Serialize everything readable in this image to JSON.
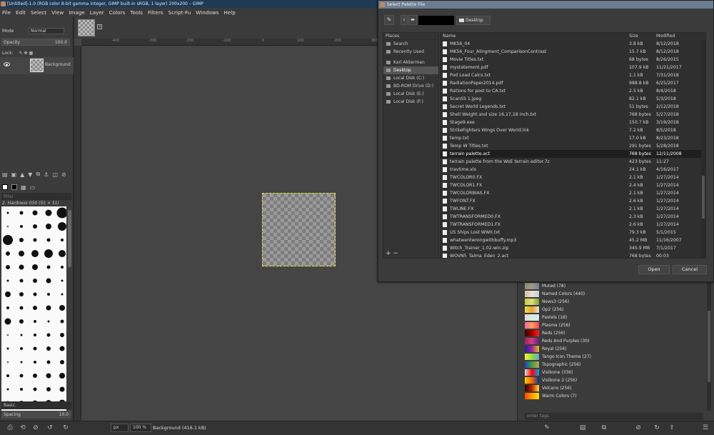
{
  "window": {
    "title": "[Untitled]-1.0 (RGB color 8-bit gamma integer, GIMP built-in sRGB, 1 layer) 200x200 – GIMP"
  },
  "menu": [
    "File",
    "Edit",
    "Select",
    "View",
    "Image",
    "Layer",
    "Colors",
    "Tools",
    "Filters",
    "Script-Fu",
    "Windows",
    "Help"
  ],
  "layers": {
    "mode_label": "Mode",
    "mode_value": "Normal",
    "opacity_label": "Opacity",
    "opacity_value": "100.0",
    "lock_label": "Lock:",
    "layer_name": "Background"
  },
  "brushes": {
    "filter_placeholder": "filter",
    "current": "2. Hardness 050 (51 × 51)",
    "preset": "Basic.",
    "spacing_label": "Spacing",
    "spacing_value": "10.0"
  },
  "ruler": [
    "-400",
    "-300",
    "-200",
    "-100",
    "0",
    "100",
    "200",
    "300",
    "400",
    "500"
  ],
  "status": {
    "unit": "px",
    "zoom": "100 %",
    "message": "Background (416.1 kB)"
  },
  "dialog": {
    "title": "Select Palette File",
    "path_current": "Desktop",
    "places_header": "Places",
    "places": [
      {
        "label": "Search",
        "selected": false
      },
      {
        "label": "Recently Used",
        "selected": false
      },
      {
        "label": "",
        "separator": true
      },
      {
        "label": "Karl Akkerman",
        "selected": false
      },
      {
        "label": "Desktop",
        "selected": true
      },
      {
        "label": "Local Disk (C:)",
        "selected": false
      },
      {
        "label": "BD-ROM Drive (D:)",
        "selected": false
      },
      {
        "label": "Local Disk (E:)",
        "selected": false
      },
      {
        "label": "Local Disk (F:)",
        "selected": false
      }
    ],
    "columns": {
      "name": "Name",
      "size": "Size",
      "modified": "Modified"
    },
    "files": [
      {
        "name": "MK56_04",
        "size": "3.8 kB",
        "modified": "8/12/2018"
      },
      {
        "name": "MK56_Four_Alingment_ComparisonContrast",
        "size": "15.7 kB",
        "modified": "8/12/2018"
      },
      {
        "name": "Movie Titles.txt",
        "size": "68 bytes",
        "modified": "8/26/2015"
      },
      {
        "name": "mystatement.pdf",
        "size": "107.9 kB",
        "modified": "11/21/2017"
      },
      {
        "name": "Pod Load Calcs.txt",
        "size": "1.1 kB",
        "modified": "7/31/2018"
      },
      {
        "name": "RadiationPaper2014.pdf",
        "size": "988.8 kB",
        "modified": "6/25/2017"
      },
      {
        "name": "Rations for post to CA.txt",
        "size": "2.5 kB",
        "modified": "8/4/2018"
      },
      {
        "name": "ScanSS 1.jpeg",
        "size": "82.1 kB",
        "modified": "5/3/2018"
      },
      {
        "name": "Secret World Legends.txt",
        "size": "51 bytes",
        "modified": "2/12/2018"
      },
      {
        "name": "Shell Weight and size 16,17,18 inch.txt",
        "size": "768 bytes",
        "modified": "5/27/2018"
      },
      {
        "name": "Stage9.exe",
        "size": "150.7 kB",
        "modified": "3/19/2018"
      },
      {
        "name": "StrikeFighters Wings Over World.lnk",
        "size": "7.2 kB",
        "modified": "8/5/2018"
      },
      {
        "name": "temp.txt",
        "size": "17.0 kB",
        "modified": "8/23/2018"
      },
      {
        "name": "Temp W Titles.txt",
        "size": "291 bytes",
        "modified": "5/28/2018"
      },
      {
        "name": "terrain palette.act",
        "size": "768 bytes",
        "modified": "12/11/2008",
        "selected": true
      },
      {
        "name": "terrain palette from the WoE terrain editor.7z",
        "size": "423 bytes",
        "modified": "11:27"
      },
      {
        "name": "travtime.xls",
        "size": "24.1 kB",
        "modified": "4/16/2017"
      },
      {
        "name": "TWCOLOR0.FX",
        "size": "2.1 kB",
        "modified": "1/27/2014"
      },
      {
        "name": "TWCOLOR1.FX",
        "size": "2.4 kB",
        "modified": "1/27/2014"
      },
      {
        "name": "TWCOLORBIAS.FX",
        "size": "2.1 kB",
        "modified": "1/27/2014"
      },
      {
        "name": "TWFONT.FX",
        "size": "2.6 kB",
        "modified": "1/27/2014"
      },
      {
        "name": "TWLINE.FX",
        "size": "2.1 kB",
        "modified": "1/27/2014"
      },
      {
        "name": "TWTRANSFORMED0.FX",
        "size": "2.3 kB",
        "modified": "1/27/2014"
      },
      {
        "name": "TWTRANSFORMED1.FX",
        "size": "2.6 kB",
        "modified": "1/27/2014"
      },
      {
        "name": "US Ships Lost WWII.txt",
        "size": "79.3 kB",
        "modified": "5/1/2015"
      },
      {
        "name": "whatwentwrongwithbuffy.mp3",
        "size": "45.2 MB",
        "modified": "11/16/2007"
      },
      {
        "name": "Witch_Trainer_1.02-win.zip",
        "size": "345.9 MB",
        "modified": "7/1/2017"
      },
      {
        "name": "WOVN5_Talma_Eden_2.act",
        "size": "768 bytes",
        "modified": "00:03"
      }
    ],
    "open_label": "Open",
    "cancel_label": "Cancel"
  },
  "palettes": {
    "items": [
      {
        "name": "Muted (78)",
        "colors": [
          "#8a8a7a",
          "#a09a88",
          "#7a8090"
        ]
      },
      {
        "name": "Named Colors (440)",
        "colors": [
          "#d0c0a0",
          "#f0e0d0",
          "#c0d0e0"
        ]
      },
      {
        "name": "News3 (256)",
        "colors": [
          "#c0d040",
          "#e0e080",
          "#80a030"
        ]
      },
      {
        "name": "Op2 (256)",
        "colors": [
          "#e0e040",
          "#f0a030",
          "#e0e0e0"
        ]
      },
      {
        "name": "Pastels (18)",
        "colors": [
          "#f0d0e0",
          "#d0f0e0",
          "#e0e0f0"
        ]
      },
      {
        "name": "Plasma (256)",
        "colors": [
          "#ff60a0",
          "#ffa060",
          "#ff4060"
        ]
      },
      {
        "name": "Reds (256)",
        "colors": [
          "#300000",
          "#a00000",
          "#ff2020"
        ]
      },
      {
        "name": "Reds And Purples (30)",
        "colors": [
          "#a02060",
          "#d04080",
          "#602080"
        ]
      },
      {
        "name": "Royal (256)",
        "colors": [
          "#2020a0",
          "#a020a0",
          "#e0c020"
        ]
      },
      {
        "name": "Tango Icon Theme (27)",
        "colors": [
          "#fce94f",
          "#8ae234",
          "#729fcf"
        ]
      },
      {
        "name": "Topographic (256)",
        "colors": [
          "#2040c0",
          "#40a040",
          "#c0a060"
        ]
      },
      {
        "name": "Visibone (336)",
        "colors": [
          "#e0e0e0",
          "#ff0000",
          "#00a0ff"
        ]
      },
      {
        "name": "Visibone 2 (256)",
        "colors": [
          "#ffcc00",
          "#ff6600",
          "#003399"
        ]
      },
      {
        "name": "Volcano (256)",
        "colors": [
          "#200000",
          "#c02000",
          "#ffe040"
        ]
      },
      {
        "name": "Warm Colors (7)",
        "colors": [
          "#ff4000",
          "#ffa000",
          "#ffe000"
        ]
      }
    ],
    "tags_placeholder": "enter tags"
  }
}
